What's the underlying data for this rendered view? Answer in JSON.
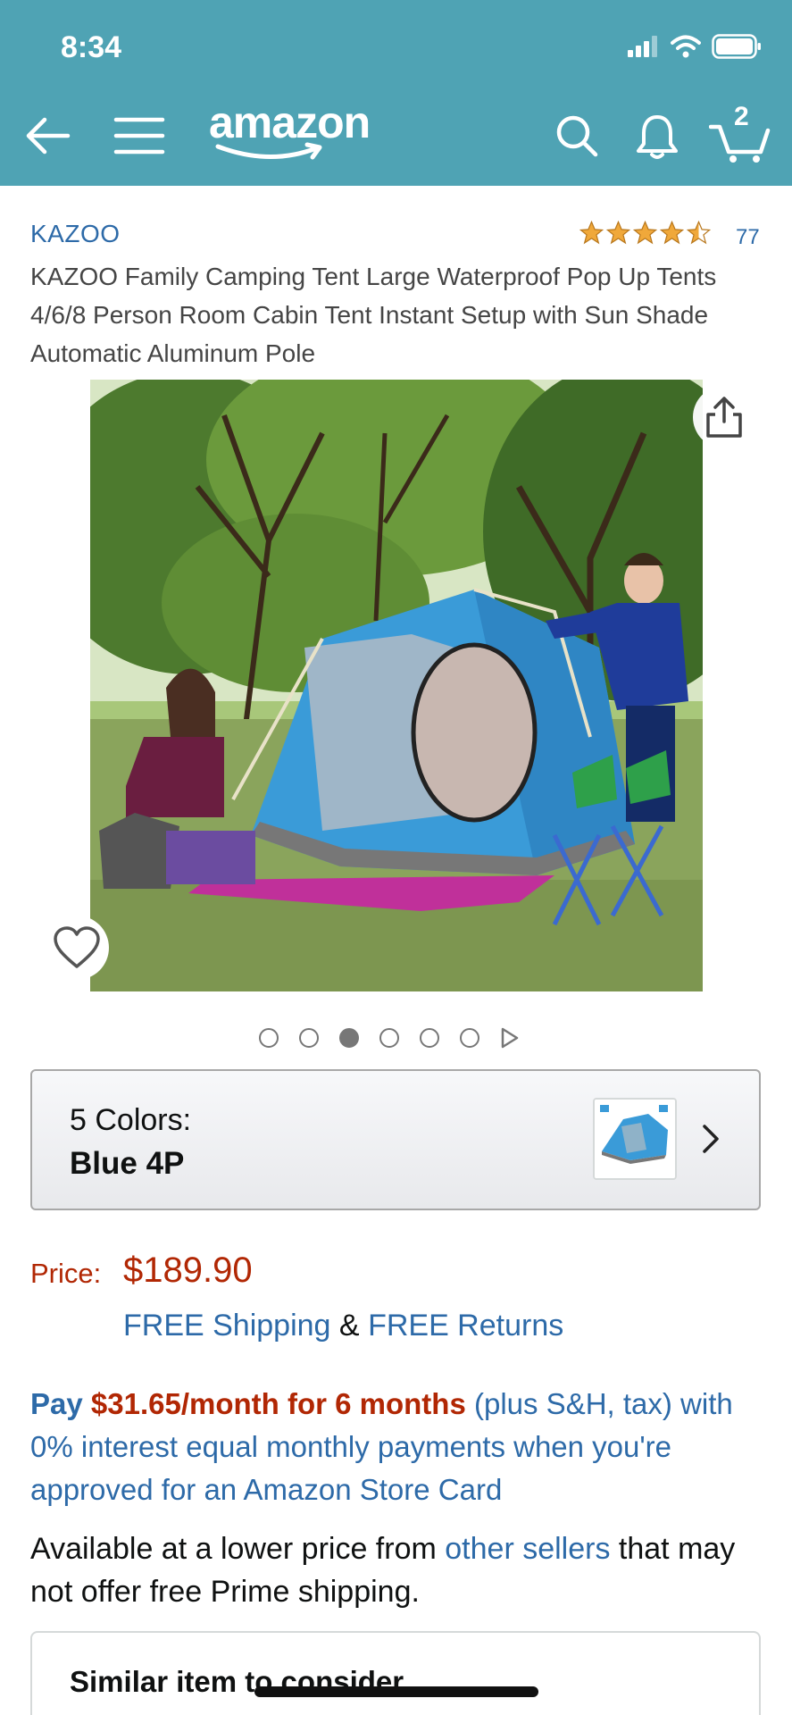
{
  "status_bar": {
    "time": "8:34"
  },
  "header": {
    "logo": "amazon",
    "cart_count": "2"
  },
  "product": {
    "brand": "KAZOO",
    "rating": 4.5,
    "review_count": "77",
    "title": "KAZOO Family Camping Tent Large Waterproof Pop Up Tents 4/6/8 Person Room Cabin Tent Instant Setup with Sun Shade Automatic Aluminum Pole"
  },
  "gallery": {
    "image_count": 6,
    "active_index": 2
  },
  "variant": {
    "label": "5 Colors:",
    "value": "Blue 4P"
  },
  "pricing": {
    "price_label": "Price:",
    "price": "$189.90",
    "free_shipping": "FREE Shipping",
    "amp": "&",
    "free_returns": "FREE Returns"
  },
  "financing": {
    "pay": "Pay",
    "amount": "$31.65/month for 6 months",
    "rest": "(plus S&H, tax) with 0% interest equal monthly payments when you're approved for an Amazon Store Card"
  },
  "availability": {
    "prefix": "Available at a lower price from",
    "link": "other sellers",
    "suffix": "that may not offer free Prime shipping."
  },
  "similar": {
    "title": "Similar item to consider"
  },
  "colors": {
    "header_bg": "#4fa3b4",
    "link": "#2d6aa8",
    "price": "#b12704",
    "star": "#f0a83a"
  }
}
